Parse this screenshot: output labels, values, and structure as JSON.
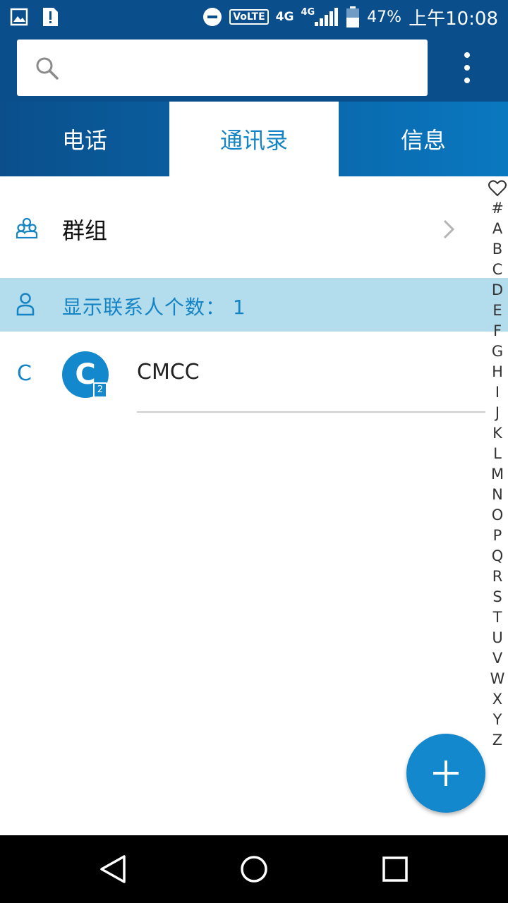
{
  "status_bar": {
    "network_label": "VoLTE",
    "net_1": "4G",
    "net_2": "4G",
    "battery": "47%",
    "time": "上午10:08"
  },
  "search": {
    "placeholder": ""
  },
  "tabs": [
    {
      "label": "电话",
      "active": false
    },
    {
      "label": "通讯录",
      "active": true
    },
    {
      "label": "信息",
      "active": false
    }
  ],
  "groups": {
    "label": "群组"
  },
  "contact_count": {
    "text": "显示联系人个数： 1"
  },
  "contacts": [
    {
      "section": "C",
      "avatar_letter": "C",
      "sim_badge": "2",
      "name": "CMCC"
    }
  ],
  "index_letters": [
    "#",
    "A",
    "B",
    "C",
    "D",
    "E",
    "F",
    "G",
    "H",
    "I",
    "J",
    "K",
    "L",
    "M",
    "N",
    "O",
    "P",
    "Q",
    "R",
    "S",
    "T",
    "U",
    "V",
    "W",
    "X",
    "Y",
    "Z"
  ],
  "colors": {
    "header_bg": "#0a4f8c",
    "accent": "#1584c4",
    "count_bar_bg": "#b3dcec",
    "fab": "#1488cc"
  },
  "icons": {
    "status_left": [
      "image-icon",
      "sim-alert-icon"
    ],
    "status_right": [
      "do-not-disturb-icon",
      "signal-icon",
      "battery-icon"
    ],
    "header": [
      "search-icon",
      "more-vert-icon"
    ],
    "nav": [
      "back-icon",
      "home-icon",
      "recents-icon"
    ]
  }
}
